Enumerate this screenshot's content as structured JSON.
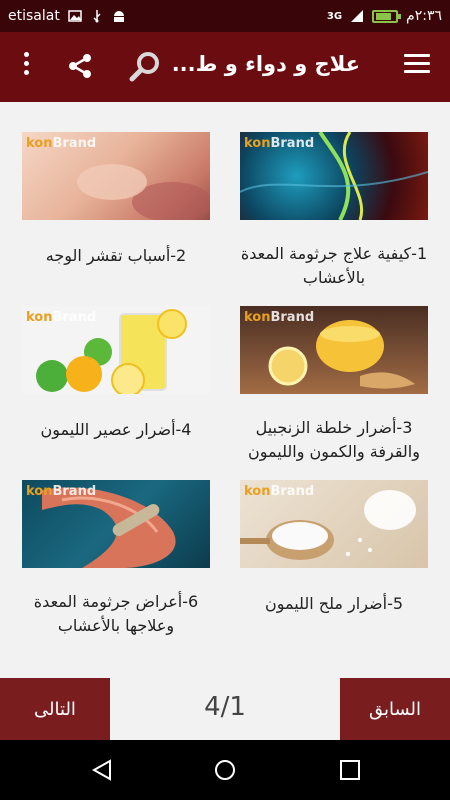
{
  "status_bar": {
    "carrier": "etisalat",
    "network": "3G",
    "time": "٢:٣٦م"
  },
  "app_bar": {
    "title": "علاج و دواء و ط..."
  },
  "articles": [
    {
      "caption": "1-كيفية علاج جرثومة المعدة بالأعشاب",
      "watermark_a": "kon",
      "watermark_b": "Brand"
    },
    {
      "caption": "2-أسباب تقشر الوجه",
      "watermark_a": "kon",
      "watermark_b": "Brand"
    },
    {
      "caption": "3-أضرار خلطة الزنجبيل والقرفة والكمون والليمون",
      "watermark_a": "kon",
      "watermark_b": "Brand"
    },
    {
      "caption": "4-أضرار عصير الليمون",
      "watermark_a": "kon",
      "watermark_b": "Brand"
    },
    {
      "caption": "5-أضرار ملح الليمون",
      "watermark_a": "kon",
      "watermark_b": "Brand"
    },
    {
      "caption": "6-أعراض جرثومة المعدة وعلاجها بالأعشاب",
      "watermark_a": "kon",
      "watermark_b": "Brand"
    }
  ],
  "pagination": {
    "prev_label": "السابق",
    "next_label": "التالى",
    "page_indicator": "4/1"
  },
  "colors": {
    "app_bar": "#6b0c10",
    "status_bar": "#3a0508",
    "nav_button": "#7a1d1f"
  }
}
